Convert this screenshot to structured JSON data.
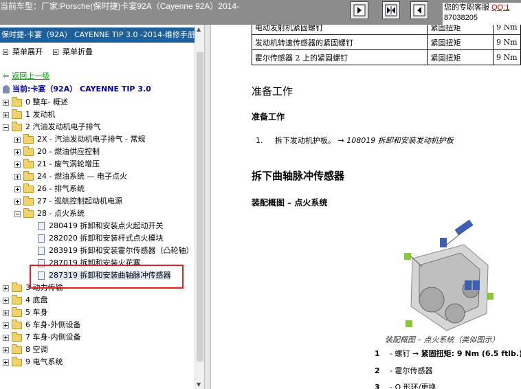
{
  "topbar": {
    "vehicle_text": "当前车型：厂家:Porsche(保时捷)卡宴92A（Cayenne 92A）2014-",
    "service_label": "您的专职客服",
    "qq_label": "QQ:1",
    "phone": "87038205",
    "colors": {
      "bar": "#8c8c8c",
      "qq": "#dd0000"
    },
    "nav_icons": [
      "jump-start-icon",
      "page-center-icon",
      "jump-end-icon"
    ]
  },
  "sidebar": {
    "manual_title": "保时捷-卡宴（92A） CAYENNE TIP 3.0 -2014-维修手册",
    "expand_label": "菜单展开",
    "collapse_label": "菜单折叠",
    "back_label": "返回上一级",
    "current_label": "当前:卡宴（92A） CAYENNE TIP 3.0",
    "title_color": "#1e5f9a",
    "tree": [
      {
        "label": "0 整车- 概述"
      },
      {
        "label": "1 发动机"
      },
      {
        "label": "2 汽油发动机电子排气"
      },
      {
        "label": "2X - 汽油发动机电子排气 - 常规"
      },
      {
        "label": "20 - 燃油供应控制"
      },
      {
        "label": "21 - 废气涡轮增压"
      },
      {
        "label": "24 - 燃油系统 — 电子点火"
      },
      {
        "label": "26 - 排气系统"
      },
      {
        "label": "27 - 巡航控制起动机电源"
      },
      {
        "label": "28 - 点火系统"
      },
      {
        "label": "280419 拆卸和安装点火起动开关"
      },
      {
        "label": "282020 拆卸和安装杆式点火模块"
      },
      {
        "label": "283919 拆卸和安装霍尔传感器（凸轮轴）"
      },
      {
        "label": "287019 拆卸和安装火花塞"
      },
      {
        "label": "287319 拆卸和安装曲轴脉冲传感器"
      },
      {
        "label": "3 动力传输"
      },
      {
        "label": "4 底盘"
      },
      {
        "label": "5 车身"
      },
      {
        "label": "6 车身-外侧设备"
      },
      {
        "label": "7 车身-内侧设备"
      },
      {
        "label": "8 空调"
      },
      {
        "label": "9 电气系统"
      }
    ]
  },
  "document": {
    "table_rows": [
      {
        "part": "电动发射机紧固螺钉",
        "type": "紧固扭矩",
        "value": "9 Nm"
      },
      {
        "part": "发动机转速传感器的紧固螺钉",
        "type": "紧固扭矩",
        "value": "9 Nm"
      },
      {
        "part": "霍尔传感器 2 上的紧固螺钉",
        "type": "紧固扭矩",
        "value": "9 Nm"
      }
    ],
    "prep_heading": "准备工作",
    "prep_subheading": "准备工作",
    "step_number": "1.",
    "step_text": "拆下发动机护板。",
    "step_ref": "→ 108019 拆卸和安装发动机护板",
    "remove_heading": "拆下曲轴脉冲传感器",
    "assembly_heading": "装配概图 – 点火系统",
    "figure_caption": "装配概图 – 点火系统（类似图示）",
    "legend": [
      {
        "num": "1",
        "text": "- 螺钉 → ",
        "bold": "紧固扭矩: 9 Nm (6.5 ftlb.)"
      },
      {
        "num": "2",
        "text": "- 霍尔传感器",
        "bold": ""
      },
      {
        "num": "3",
        "text": "- O 形环/更换",
        "bold": ""
      }
    ]
  }
}
